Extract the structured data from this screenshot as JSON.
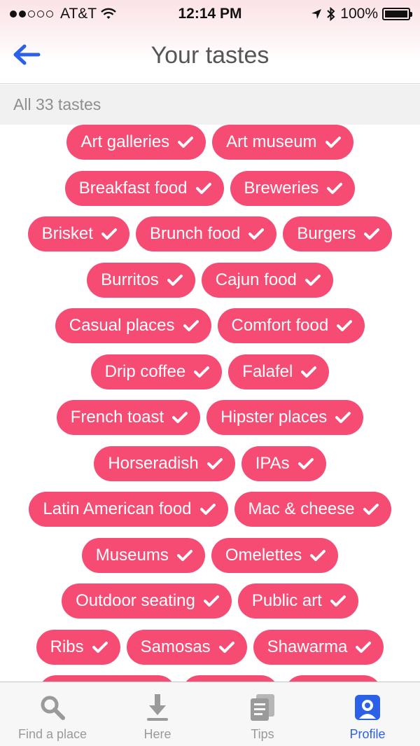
{
  "status": {
    "carrier": "AT&T",
    "time": "12:14 PM",
    "battery": "100%",
    "signal_bars": 2,
    "signal_total": 5
  },
  "nav": {
    "title": "Your tastes",
    "back_icon": "back-arrow-icon"
  },
  "section": {
    "header": "All 33 tastes"
  },
  "tastes": [
    [
      "Art galleries",
      "Art museum"
    ],
    [
      "Breakfast food",
      "Breweries"
    ],
    [
      "Brisket",
      "Brunch food",
      "Burgers"
    ],
    [
      "Burritos",
      "Cajun food"
    ],
    [
      "Casual places",
      "Comfort food"
    ],
    [
      "Drip coffee",
      "Falafel"
    ],
    [
      "French toast",
      "Hipster places"
    ],
    [
      "Horseradish",
      "IPAs"
    ],
    [
      "Latin American food",
      "Mac & cheese"
    ],
    [
      "Museums",
      "Omelettes"
    ],
    [
      "Outdoor seating",
      "Public art"
    ],
    [
      "Ribs",
      "Samosas",
      "Shawarma"
    ]
  ],
  "tabs": [
    {
      "label": "Find a place",
      "icon": "search-icon",
      "active": false
    },
    {
      "label": "Here",
      "icon": "download-arrow-icon",
      "active": false
    },
    {
      "label": "Tips",
      "icon": "tips-icon",
      "active": false
    },
    {
      "label": "Profile",
      "icon": "profile-icon",
      "active": true
    }
  ],
  "colors": {
    "pill": "#f64c74",
    "accent": "#2b61e6",
    "tab_inactive": "#9a9a9a"
  }
}
